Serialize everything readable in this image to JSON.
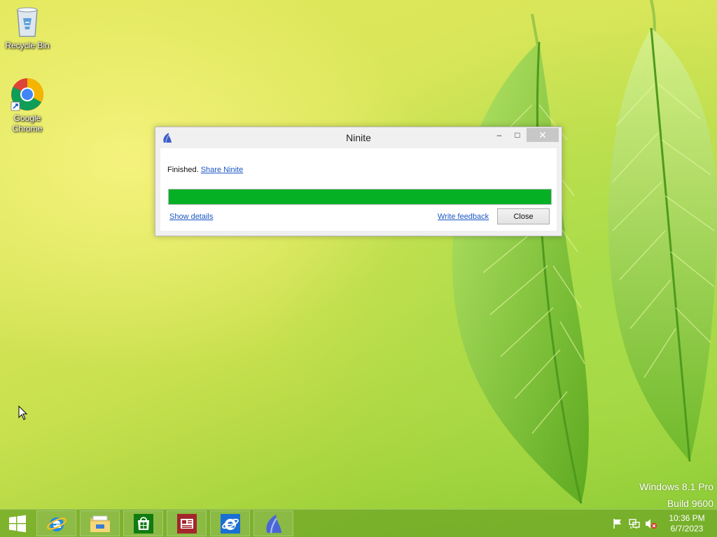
{
  "desktop": {
    "icons": [
      {
        "label": "Recycle Bin",
        "icon": "recycle-bin-icon"
      },
      {
        "label": "Google Chrome",
        "icon": "chrome-icon"
      }
    ],
    "watermark": {
      "line1": "Windows 8.1 Pro",
      "line2": "Build 9600"
    }
  },
  "window": {
    "title": "Ninite",
    "app_icon": "ninite-icon",
    "controls": {
      "minimize": "–",
      "maximize": "□",
      "close": "✕"
    },
    "status_text": "Finished.",
    "share_link": "Share Ninite",
    "progress": 1.0,
    "progress_color": "#06b025",
    "show_details_link": "Show details",
    "write_feedback_link": "Write feedback",
    "close_button": "Close"
  },
  "taskbar": {
    "start_icon": "windows-start-icon",
    "apps": [
      {
        "name": "Internet Explorer",
        "icon": "ie-icon"
      },
      {
        "name": "File Explorer",
        "icon": "file-explorer-icon"
      },
      {
        "name": "Store",
        "icon": "store-icon"
      },
      {
        "name": "News",
        "icon": "news-icon"
      },
      {
        "name": "Internet Explorer",
        "icon": "ie-metro-icon"
      },
      {
        "name": "Ninite",
        "icon": "ninite-icon"
      }
    ],
    "tray_icons": [
      "flag-icon",
      "network-icon",
      "volume-muted-icon"
    ],
    "clock": {
      "time": "10:36 PM",
      "date": "6/7/2023"
    }
  }
}
